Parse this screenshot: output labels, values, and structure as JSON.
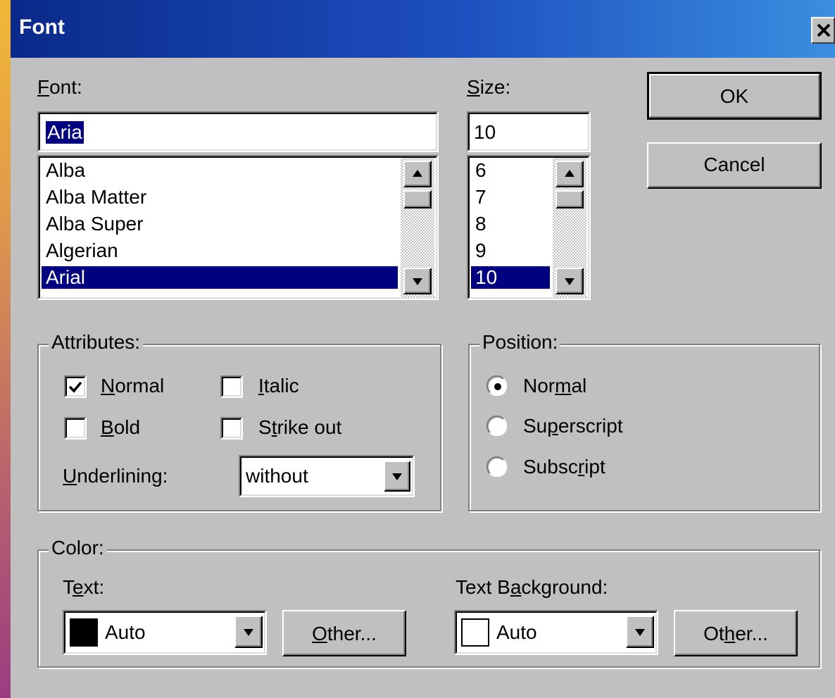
{
  "window": {
    "title": "Font"
  },
  "font": {
    "label": "Font:",
    "value": "Aria",
    "items": [
      "Alba",
      "Alba Matter",
      "Alba Super",
      "Algerian",
      "Arial"
    ],
    "selected_index": 4
  },
  "size": {
    "label": "Size:",
    "value": "10",
    "items": [
      "6",
      "7",
      "8",
      "9",
      "10"
    ],
    "selected_index": 4
  },
  "buttons": {
    "ok": "OK",
    "cancel": "Cancel"
  },
  "attributes": {
    "label": "Attributes:",
    "normal": {
      "label": "Normal",
      "checked": true
    },
    "italic": {
      "label": "Italic",
      "checked": false
    },
    "bold": {
      "label": "Bold",
      "checked": false
    },
    "strike_out": {
      "label": "Strike out",
      "checked": false
    },
    "underlining_label": "Underlining:",
    "underlining_value": "without"
  },
  "position": {
    "label": "Position:",
    "options": [
      "Normal",
      "Superscript",
      "Subscript"
    ],
    "selected": "Normal"
  },
  "color": {
    "label": "Color:",
    "text_label": "Text:",
    "text_value": "Auto",
    "text_swatch": "#000000",
    "background_label": "Text Background:",
    "background_value": "Auto",
    "background_swatch": "#ffffff",
    "other_label": "Other...",
    "other_label_2": "Other..."
  },
  "colors": {
    "title_start": "#0a2a8a",
    "title_end": "#3a8ee0",
    "selection": "#000080",
    "dialog_bg": "#c0c0c0"
  }
}
